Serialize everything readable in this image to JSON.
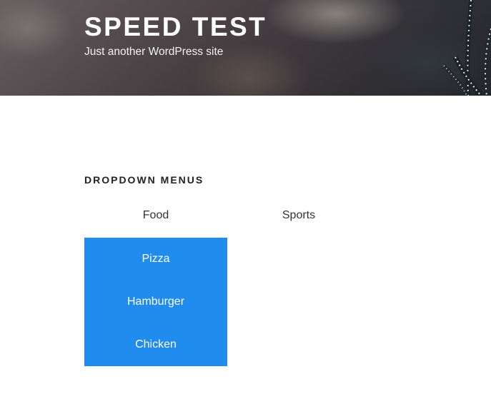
{
  "header": {
    "site_title": "SPEED TEST",
    "site_description": "Just another WordPress site"
  },
  "widget": {
    "title": "DROPDOWN MENUS"
  },
  "menu": {
    "items": [
      {
        "label": "Food",
        "submenu": [
          "Pizza",
          "Hamburger",
          "Chicken"
        ]
      },
      {
        "label": "Sports"
      }
    ]
  },
  "colors": {
    "submenu_background": "#208ced",
    "submenu_text": "#ffffff",
    "menu_text": "#333333"
  }
}
